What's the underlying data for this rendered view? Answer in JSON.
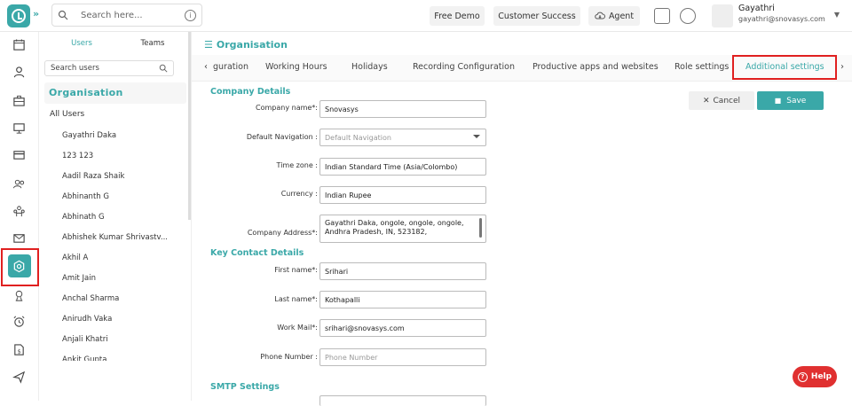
{
  "topbar": {
    "search_placeholder": "Search here...",
    "free_demo": "Free Demo",
    "customer_success": "Customer Success",
    "agent": "Agent",
    "user_name": "Gayathri",
    "user_email": "gayathri@snovasys.com"
  },
  "sidebar": {
    "tab_users": "Users",
    "tab_teams": "Teams",
    "search_placeholder": "Search users",
    "org_title": "Organisation",
    "all_users": "All Users",
    "users": [
      "Gayathri Daka",
      "123 123",
      "Aadil Raza Shaik",
      "Abhinanth G",
      "Abhinath G",
      "Abhishek Kumar Shrivastv...",
      "Akhil A",
      "Amit Jain",
      "Anchal Sharma",
      "Anirudh Vaka",
      "Anjali Khatri",
      "Ankit Gupta"
    ]
  },
  "main": {
    "breadcrumb": "Organisation",
    "tabs": {
      "configuration": "guration",
      "working_hours": "Working Hours",
      "holidays": "Holidays",
      "recording": "Recording Configuration",
      "productive": "Productive apps and websites",
      "role": "Role settings",
      "additional": "Additional settings"
    },
    "cancel": "Cancel",
    "save": "Save",
    "company_details": "Company Details",
    "key_contact": "Key Contact Details",
    "smtp": "SMTP Settings",
    "fields": {
      "company_name_label": "Company name*:",
      "company_name": "Snovasys",
      "default_nav_label": "Default Navigation :",
      "default_nav_placeholder": "Default Navigation",
      "timezone_label": "Time zone :",
      "timezone": "Indian Standard Time (Asia/Colombo)",
      "currency_label": "Currency :",
      "currency": "Indian Rupee",
      "address_label": "Company Address*:",
      "address": "Gayathri Daka, ongole, ongole, ongole, Andhra Pradesh, IN, 523182,",
      "first_name_label": "First name*:",
      "first_name": "Srihari",
      "last_name_label": "Last name*:",
      "last_name": "Kothapalli",
      "work_mail_label": "Work Mail*:",
      "work_mail": "srihari@snovasys.com",
      "phone_label": "Phone Number :",
      "phone_placeholder": "Phone Number"
    },
    "help": "Help"
  },
  "colors": {
    "accent": "#3aa8a8",
    "highlight": "#e02020"
  }
}
